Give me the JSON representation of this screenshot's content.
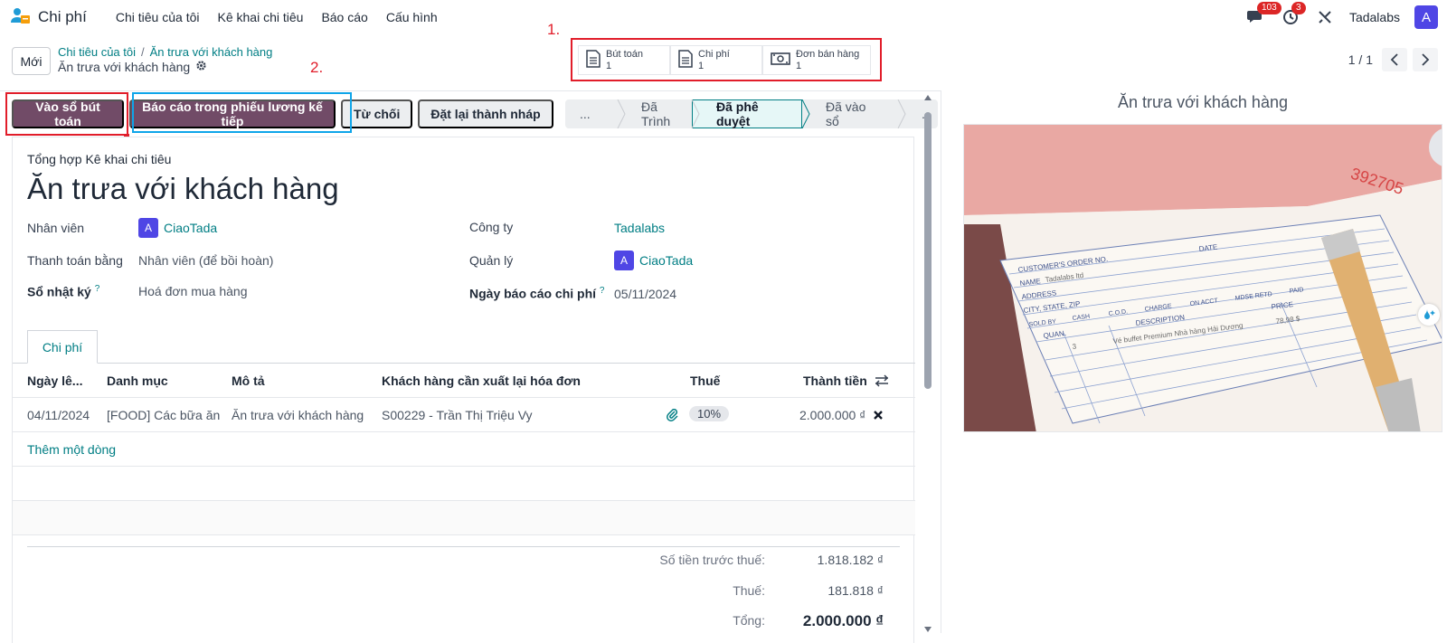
{
  "app": {
    "name": "Chi phí"
  },
  "menu": [
    "Chi tiêu của tôi",
    "Kê khai chi tiêu",
    "Báo cáo",
    "Cấu hình"
  ],
  "systray": {
    "messages_count": "103",
    "activities_count": "3",
    "company": "Tadalabs",
    "user_initial": "A"
  },
  "control": {
    "new_label": "Mới",
    "breadcrumb": [
      "Chi tiêu của tôi",
      "Ăn trưa với khách hàng"
    ],
    "current": "Ăn trưa với khách hàng",
    "annotation_1": "1.",
    "annotation_2": "2.",
    "smart_buttons": [
      {
        "label": "Bút toán",
        "count": "1"
      },
      {
        "label": "Chi phí",
        "count": "1"
      },
      {
        "label": "Đơn bán hàng",
        "count": "1"
      }
    ],
    "pager": "1 / 1"
  },
  "actions": {
    "post": "Vào sổ bút toán",
    "report_payslip": "Báo cáo trong phiếu lương kế tiếp",
    "refuse": "Từ chối",
    "reset": "Đặt lại thành nháp"
  },
  "status": [
    "...",
    "Đã Trình",
    "Đã phê duyệt",
    "Đã vào sổ",
    "..."
  ],
  "status_active": "Đã phê duyệt",
  "form": {
    "subtitle": "Tổng hợp Kê khai chi tiêu",
    "title": "Ăn trưa với khách hàng",
    "employee_label": "Nhân viên",
    "employee": "CiaoTada",
    "paid_by_label": "Thanh toán bằng",
    "paid_by": "Nhân viên (để bồi hoàn)",
    "journal_label": "Sổ nhật ký",
    "journal": "Hoá đơn mua hàng",
    "company_label": "Công ty",
    "company": "Tadalabs",
    "manager_label": "Quản lý",
    "manager": "CiaoTada",
    "date_label": "Ngày báo cáo chi phí",
    "date": "05/11/2024",
    "help": "?",
    "avatar": "A"
  },
  "tab": "Chi phí",
  "table": {
    "headers": [
      "Ngày lê...",
      "Danh mục",
      "Mô tả",
      "Khách hàng cần xuất lại hóa đơn",
      "Thuế",
      "Thành tiền"
    ],
    "rows": [
      {
        "date": "04/11/2024",
        "category": "[FOOD] Các bữa ăn",
        "description": "Ăn trưa với khách hàng",
        "customer": "S00229 - Trần Thị Triệu Vy",
        "tax": "10%",
        "amount": "2.000.000 ₫"
      }
    ],
    "add_line": "Thêm một dòng"
  },
  "totals": {
    "untaxed_label": "Số tiền trước thuế:",
    "untaxed": "1.818.182 ₫",
    "tax_label": "Thuế:",
    "tax": "181.818 ₫",
    "total_label": "Tổng:",
    "total": "2.000.000 ₫"
  },
  "preview": {
    "title": "Ăn trưa với khách hàng",
    "receipt_number": "392705",
    "receipt_headers": [
      "CUSTOMER'S ORDER NO.",
      "DATE",
      "NAME",
      "ADDRESS",
      "CITY, STATE, ZIP",
      "SOLD BY",
      "CASH",
      "C.O.D.",
      "CHARGE",
      "ON ACCT",
      "MDSE RETD",
      "PAID",
      "QUAN.",
      "DESCRIPTION",
      "PRICE"
    ],
    "receipt_name": "Tadalabs ltd",
    "receipt_line": "Vé buffet Premium Nhà hàng Hải Dương",
    "receipt_qty": "3",
    "receipt_price": "78,98 $"
  }
}
